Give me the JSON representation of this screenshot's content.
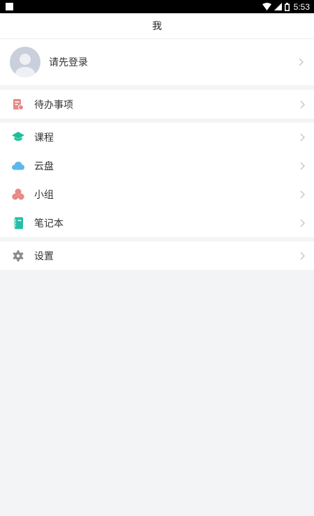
{
  "status_bar": {
    "time": "5:53"
  },
  "header": {
    "title": "我"
  },
  "profile": {
    "login_prompt": "请先登录"
  },
  "menu": {
    "todo": {
      "label": "待办事项",
      "icon": "todo-icon",
      "color": "#e88a86"
    },
    "course": {
      "label": "课程",
      "icon": "graduation-cap-icon",
      "color": "#1bbf9b"
    },
    "cloud": {
      "label": "云盘",
      "icon": "cloud-icon",
      "color": "#5cb8ea"
    },
    "group": {
      "label": "小组",
      "icon": "group-icon",
      "color": "#e88a86"
    },
    "notebook": {
      "label": "笔记本",
      "icon": "notebook-icon",
      "color": "#23bfa7"
    },
    "settings": {
      "label": "设置",
      "icon": "gear-icon",
      "color": "#8a8a8a"
    }
  }
}
